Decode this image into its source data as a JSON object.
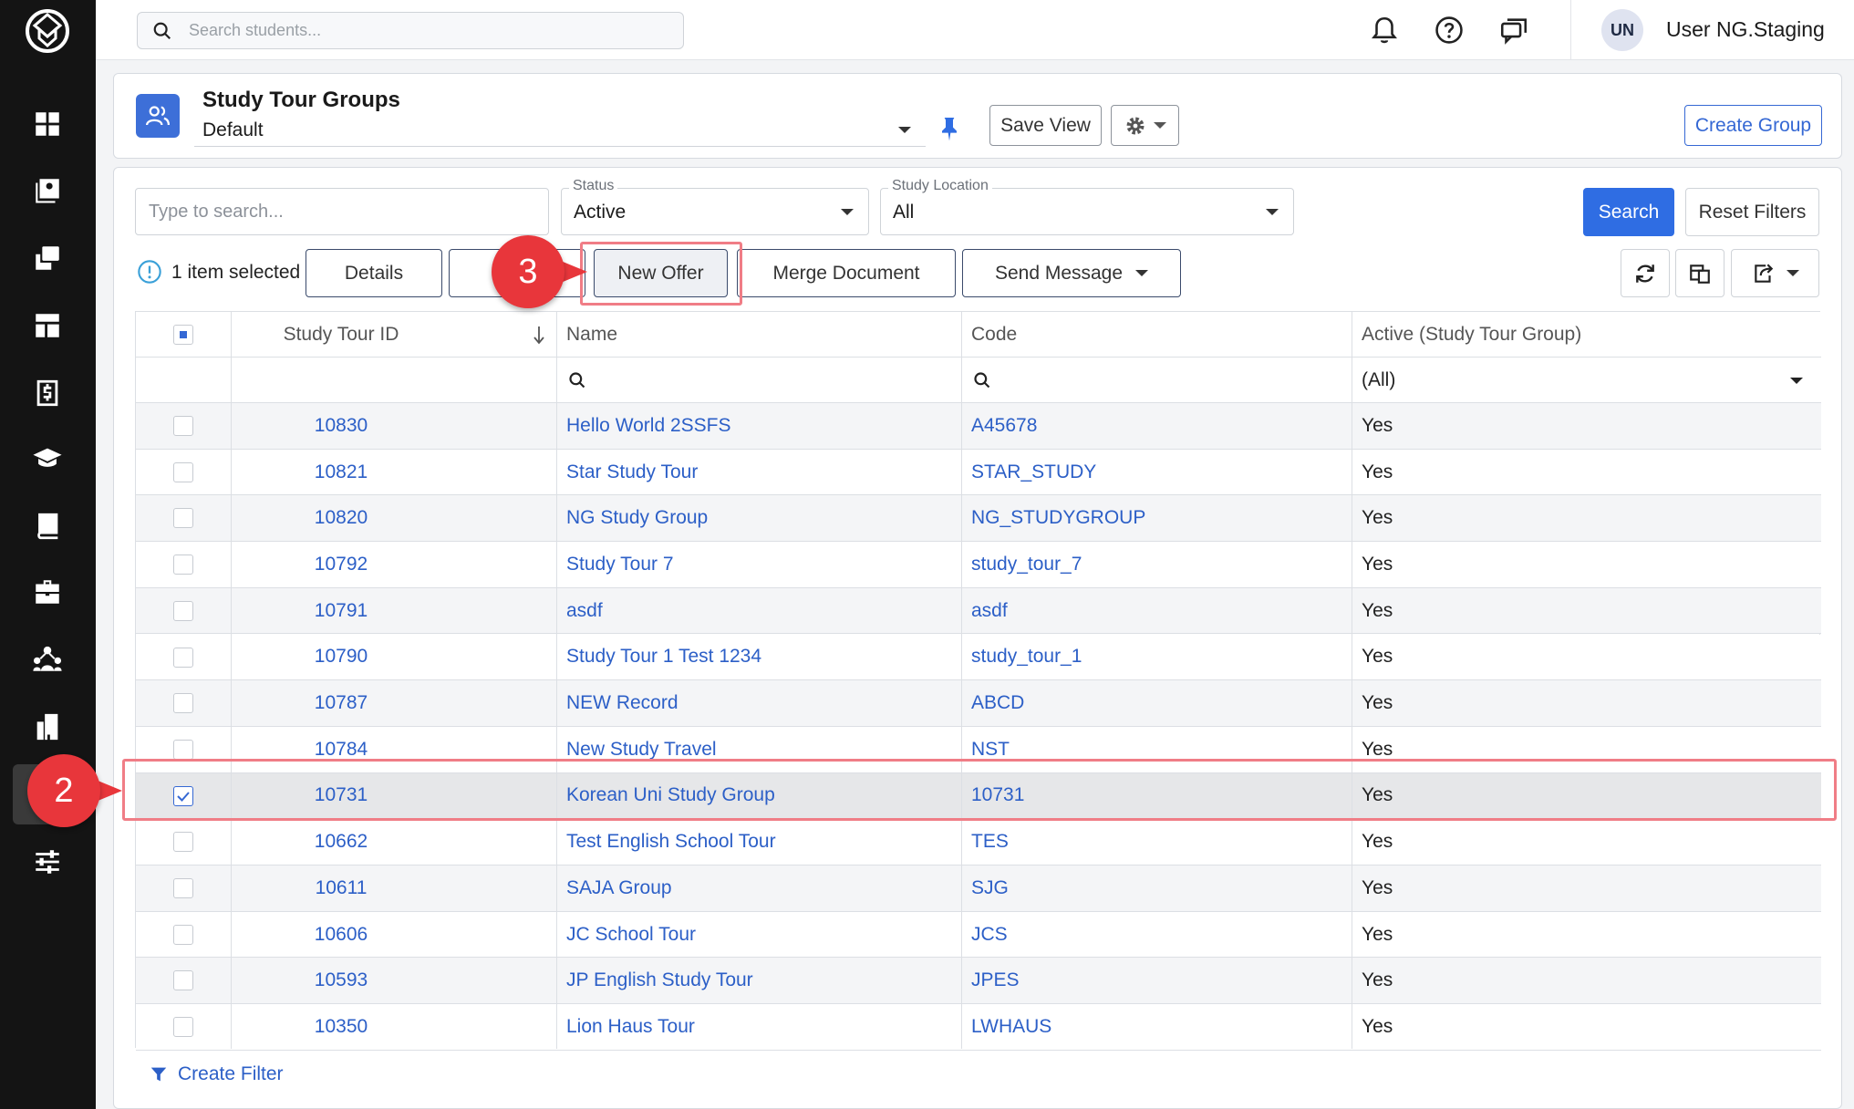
{
  "sidebar": {
    "items": [
      {
        "icon": "dashboard-icon"
      },
      {
        "icon": "contacts-icon"
      },
      {
        "icon": "copy-stack-icon"
      },
      {
        "icon": "layout-icon"
      },
      {
        "icon": "finance-icon"
      },
      {
        "icon": "graduation-cap-icon"
      },
      {
        "icon": "book-icon"
      },
      {
        "icon": "briefcase-icon"
      },
      {
        "icon": "agents-network-icon"
      },
      {
        "icon": "building-icon",
        "active": false
      },
      {
        "icon": "study-tour-icon",
        "active": true
      },
      {
        "icon": "settings-sliders-icon"
      }
    ]
  },
  "topbar": {
    "search_placeholder": "Search students...",
    "user_initials": "UN",
    "user_name": "User NG.Staging"
  },
  "header": {
    "title": "Study Tour Groups",
    "view_value": "Default",
    "save_view_label": "Save View",
    "create_group_label": "Create Group"
  },
  "filters": {
    "search_placeholder": "Type to search...",
    "status_label": "Status",
    "status_value": "Active",
    "location_label": "Study Location",
    "location_value": "All",
    "search_button": "Search",
    "reset_button": "Reset Filters"
  },
  "actions": {
    "selected_text": "1 item selected",
    "details": "Details",
    "new_offer": "New Offer",
    "merge_document": "Merge Document",
    "send_message": "Send Message"
  },
  "table": {
    "columns": [
      "Study Tour ID",
      "Name",
      "Code",
      "Active (Study Tour Group)"
    ],
    "active_filter_value": "(All)",
    "rows": [
      {
        "id": "10830",
        "name": "Hello World 2SSFS",
        "code": "A45678",
        "active": "Yes",
        "checked": false
      },
      {
        "id": "10821",
        "name": "Star Study Tour",
        "code": "STAR_STUDY",
        "active": "Yes",
        "checked": false
      },
      {
        "id": "10820",
        "name": "NG Study Group",
        "code": "NG_STUDYGROUP",
        "active": "Yes",
        "checked": false
      },
      {
        "id": "10792",
        "name": "Study Tour 7",
        "code": "study_tour_7",
        "active": "Yes",
        "checked": false
      },
      {
        "id": "10791",
        "name": "asdf",
        "code": "asdf",
        "active": "Yes",
        "checked": false
      },
      {
        "id": "10790",
        "name": "Study Tour 1 Test 1234",
        "code": "study_tour_1",
        "active": "Yes",
        "checked": false
      },
      {
        "id": "10787",
        "name": "NEW Record",
        "code": "ABCD",
        "active": "Yes",
        "checked": false
      },
      {
        "id": "10784",
        "name": "New Study Travel",
        "code": "NST",
        "active": "Yes",
        "checked": false
      },
      {
        "id": "10731",
        "name": "Korean Uni Study Group",
        "code": "10731",
        "active": "Yes",
        "checked": true
      },
      {
        "id": "10662",
        "name": "Test English School Tour",
        "code": "TES",
        "active": "Yes",
        "checked": false
      },
      {
        "id": "10611",
        "name": "SAJA Group",
        "code": "SJG",
        "active": "Yes",
        "checked": false
      },
      {
        "id": "10606",
        "name": "JC School Tour",
        "code": "JCS",
        "active": "Yes",
        "checked": false
      },
      {
        "id": "10593",
        "name": "JP English Study Tour",
        "code": "JPES",
        "active": "Yes",
        "checked": false
      },
      {
        "id": "10350",
        "name": "Lion Haus Tour",
        "code": "LWHAUS",
        "active": "Yes",
        "checked": false
      }
    ]
  },
  "footer": {
    "create_filter": "Create Filter"
  },
  "annotations": {
    "step_row": "2",
    "step_button": "3"
  },
  "colors": {
    "primary": "#2f6de3",
    "link": "#2c5fc7",
    "annotation": "#e8363b",
    "sidebar_bg": "#141414"
  }
}
